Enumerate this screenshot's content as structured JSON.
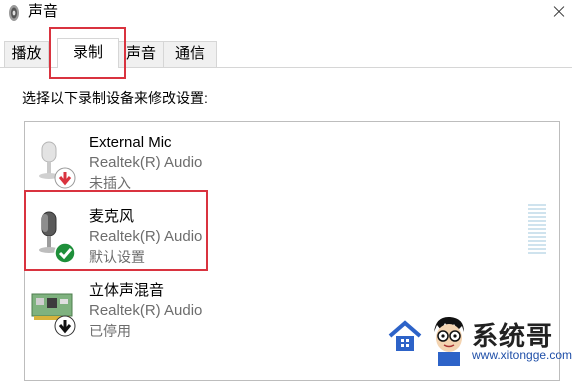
{
  "window": {
    "title": "声音"
  },
  "tabs": [
    {
      "label": "播放"
    },
    {
      "label": "录制"
    },
    {
      "label": "声音"
    },
    {
      "label": "通信"
    }
  ],
  "active_tab": "录制",
  "instruction": "选择以下录制设备来修改设置:",
  "devices": [
    {
      "name": "External Mic",
      "driver": "Realtek(R) Audio",
      "status": "未插入",
      "icon": "microphone-unplugged-icon",
      "selected": false
    },
    {
      "name": "麦克风",
      "driver": "Realtek(R) Audio",
      "status": "默认设置",
      "icon": "microphone-default-icon",
      "selected": true
    },
    {
      "name": "立体声混音",
      "driver": "Realtek(R) Audio",
      "status": "已停用",
      "icon": "sound-card-disabled-icon",
      "selected": false
    }
  ],
  "colors": {
    "highlight": "#d9333f",
    "default_check": "#1e8f3a",
    "unplugged_arrow": "#d9333f"
  },
  "watermark": {
    "brand": "系统哥",
    "url": "www.xitongge.com"
  }
}
